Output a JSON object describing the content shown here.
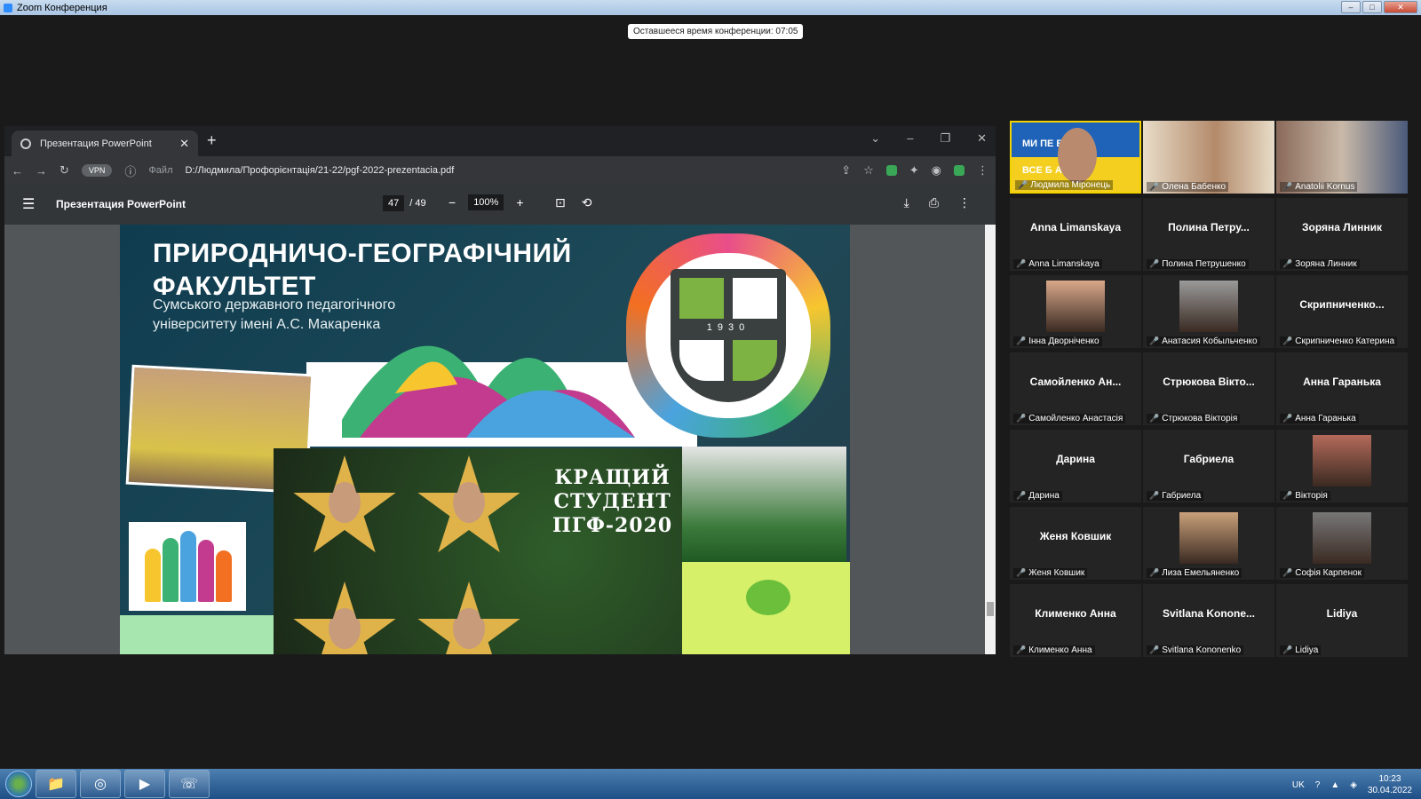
{
  "zoom": {
    "window_title": "Zoom Конференция",
    "time_remaining": "Оставшееся время конференции: 07:05"
  },
  "browser": {
    "tab_title": "Презентация PowerPoint",
    "vpn_label": "VPN",
    "file_label": "Файл",
    "url": "D:/Людмила/Профорієнтація/21-22/pgf-2022-prezentacia.pdf"
  },
  "pdf": {
    "doc_title": "Презентация PowerPoint",
    "current_page": "47",
    "total_pages": "/ 49",
    "zoom": "100%"
  },
  "slide": {
    "title_line1": "ПРИРОДНИЧО-ГЕОГРАФІЧНИЙ",
    "title_line2": "ФАКУЛЬТЕТ",
    "subtitle_line1": "Сумського державного педагогічного",
    "subtitle_line2": "університету імені А.С. Макаренка",
    "crest_year": "1930",
    "best_student_line1": "КРАЩИЙ",
    "best_student_line2": "СТУДЕНТ",
    "best_student_line3": "ПГФ-2020"
  },
  "participants": [
    {
      "big": "",
      "small": "Людмила Міронець",
      "type": "video-banner"
    },
    {
      "big": "",
      "small": "Олена Бабенко",
      "type": "video"
    },
    {
      "big": "",
      "small": "Anatolii Kornus",
      "type": "video"
    },
    {
      "big": "Anna Limanskaya",
      "small": "Anna Limanskaya",
      "type": "name"
    },
    {
      "big": "Полина Петру...",
      "small": "Полина Петрушенко",
      "type": "name"
    },
    {
      "big": "Зоряна Линник",
      "small": "Зоряна Линник",
      "type": "name"
    },
    {
      "big": "",
      "small": "Інна Дворніченко",
      "type": "photo"
    },
    {
      "big": "",
      "small": "Анатасия Кобыльченко",
      "type": "photo"
    },
    {
      "big": "Скрипниченко...",
      "small": "Скрипниченко Катерина",
      "type": "name"
    },
    {
      "big": "Самойленко Ан...",
      "small": "Самойленко Анастасія",
      "type": "name"
    },
    {
      "big": "Стрюкова Вікто...",
      "small": "Стрюкова Вікторія",
      "type": "name"
    },
    {
      "big": "Анна Гаранька",
      "small": "Анна Гаранька",
      "type": "name"
    },
    {
      "big": "Дарина",
      "small": "Дарина",
      "type": "name"
    },
    {
      "big": "Габриела",
      "small": "Габриела",
      "type": "name"
    },
    {
      "big": "",
      "small": "Вікторія",
      "type": "photo"
    },
    {
      "big": "Женя Ковшик",
      "small": "Женя Ковшик",
      "type": "name"
    },
    {
      "big": "",
      "small": "Лиза Емельяненко",
      "type": "photo"
    },
    {
      "big": "",
      "small": "Софія Карпенок",
      "type": "photo"
    },
    {
      "big": "Клименко Анна",
      "small": "Клименко Анна",
      "type": "name"
    },
    {
      "big": "Svitlana Konone...",
      "small": "Svitlana Kononenko",
      "type": "name"
    },
    {
      "big": "Lidiya",
      "small": "Lidiya",
      "type": "name"
    }
  ],
  "banner": {
    "line1": "МИ ПЕ      ЕМО!",
    "line2": "ВСЕ Б      АЇНА!"
  },
  "taskbar": {
    "lang": "UK",
    "time": "10:23",
    "date": "30.04.2022"
  }
}
